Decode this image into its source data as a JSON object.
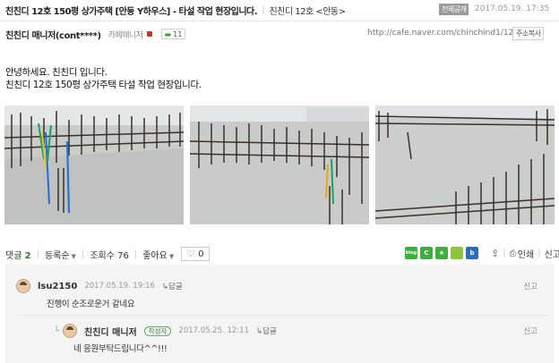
{
  "header": {
    "title": "친친디 12호 150평 상가주택 [안동 Y하우스] - 타설 작업 현장입니다.",
    "board": "친친디 12호 <안동>",
    "visibility": "전체공개",
    "date": "2017.05.19. 17:35"
  },
  "author": {
    "name": "친친디 매니저(cont****)",
    "level": "카페매니저",
    "comment_count": "11",
    "url": "http://cafe.naver.com/chinchind1/1274",
    "copy_url_label": "주소복사"
  },
  "body": {
    "line1": "안녕하세요.  친친디 입니다.",
    "line2": "친친디 12호 150평 상가주택 타설 작업 현장입니다."
  },
  "photos": [
    {
      "name": "photo-1"
    },
    {
      "name": "photo-2"
    },
    {
      "name": "photo-3"
    }
  ],
  "comment_bar": {
    "comments_label": "댓글",
    "comments_count": "2",
    "sort_label": "등록순",
    "views_label": "조회수",
    "views_count": "76",
    "likes_label": "좋아요",
    "like_count": "0",
    "print_label": "인쇄",
    "report_label": "신고",
    "share_icons": [
      {
        "name": "blog-share-icon",
        "text": "blog",
        "color": "#3fae3f"
      },
      {
        "name": "cafe-share-icon",
        "text": "C",
        "color": "#3fae3f"
      },
      {
        "name": "star-share-icon",
        "text": "★",
        "color": "#3fae3f"
      },
      {
        "name": "memo-share-icon",
        "text": "",
        "color": "#8cc63f"
      },
      {
        "name": "band-share-icon",
        "text": "b",
        "color": "#2d6db5"
      }
    ]
  },
  "comments": [
    {
      "author": "lsu2150",
      "date": "2017.05.19. 19:16",
      "reply_label": "답글",
      "report_label": "신고",
      "text": "진행이 순조로운거 같네요"
    },
    {
      "author": "친친디 매니저",
      "badge": "작성자",
      "date": "2017.05.25. 12:11",
      "reply_label": "답글",
      "report_label": "신고",
      "text": "네 응원부탁드립니다^^!!!"
    }
  ]
}
